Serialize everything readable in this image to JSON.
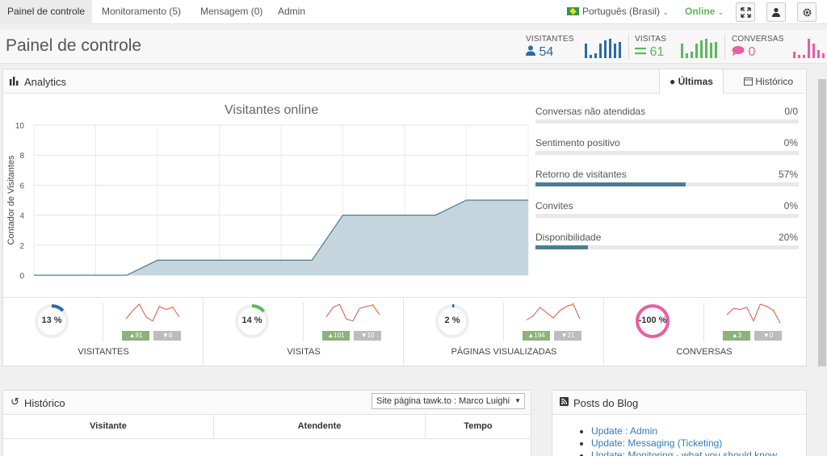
{
  "nav": {
    "items": [
      "Painel de controle",
      "Monitoramento (5)",
      "Mensagem (0)",
      "Admin"
    ],
    "language": "Português (Brasil)",
    "status": "Online"
  },
  "header": {
    "title": "Painel de controle",
    "stats": [
      {
        "label": "VISITANTES",
        "value": "54",
        "color": "#2a6ba0",
        "icon": "user-icon"
      },
      {
        "label": "VISITAS",
        "value": "61",
        "color": "#5cb85c",
        "icon": "bars-icon"
      },
      {
        "label": "CONVERSAS",
        "value": "0",
        "color": "#e85fa0",
        "icon": "chat-icon"
      }
    ]
  },
  "analytics": {
    "title": "Analytics",
    "tabs": [
      "Últimas",
      "Histórico"
    ],
    "metrics": [
      {
        "label": "Conversas não atendidas",
        "value": "0/0",
        "fill": 0
      },
      {
        "label": "Sentimento positivo",
        "value": "0%",
        "fill": 0
      },
      {
        "label": "Retorno de visitantes",
        "value": "57%",
        "fill": 0.57
      },
      {
        "label": "Convites",
        "value": "0%",
        "fill": 0
      },
      {
        "label": "Disponibilidade",
        "value": "20%",
        "fill": 0.2
      }
    ],
    "kpis": [
      {
        "caption": "VISITANTES",
        "percent": "13 %",
        "ratio": 0.13,
        "color": "#2a6ba0",
        "up": "91",
        "down": "8",
        "trend": [
          0.3,
          0.7,
          1.0,
          0.4,
          0.2,
          0.9,
          0.75,
          0.85,
          0.4
        ]
      },
      {
        "caption": "VISITAS",
        "percent": "14 %",
        "ratio": 0.14,
        "color": "#5cb85c",
        "up": "101",
        "down": "10",
        "trend": [
          0.4,
          0.85,
          1.0,
          0.3,
          0.2,
          0.8,
          0.9,
          0.95,
          0.5
        ]
      },
      {
        "caption": "PÁGINAS VISUALIZADAS",
        "percent": "2 %",
        "ratio": 0.02,
        "color": "#2a6ba0",
        "up": "194",
        "down": "21",
        "trend": [
          0.25,
          0.45,
          0.85,
          0.6,
          0.35,
          0.7,
          0.9,
          1.0,
          0.3
        ]
      },
      {
        "caption": "CONVERSAS",
        "percent": "-100 %",
        "ratio": 1,
        "color": "#e85fa0",
        "up": "3",
        "down": "0",
        "trend": [
          0.5,
          0.8,
          0.75,
          0.85,
          0.2,
          1.0,
          0.9,
          0.7,
          0.1
        ]
      }
    ]
  },
  "chart_data": {
    "type": "area",
    "title": "Visitantes online",
    "ylabel": "Contador de Visitantes",
    "xlabel": "",
    "ylim": [
      0,
      10
    ],
    "yticks": [
      0,
      2,
      4,
      6,
      8,
      10
    ],
    "x": [
      0,
      1,
      2,
      3,
      4,
      5,
      6,
      7,
      8,
      9,
      10,
      11,
      12,
      13,
      14,
      15,
      16
    ],
    "series": [
      {
        "values": [
          0,
          0,
          0,
          0,
          1,
          1,
          1,
          1,
          1,
          1,
          4,
          4,
          4,
          4,
          5,
          5,
          5
        ]
      }
    ],
    "grid": true
  },
  "history": {
    "title": "Histórico",
    "site_select": "Site página tawk.to : Marco Luighi",
    "columns": [
      "Visitante",
      "Atendente",
      "Tempo"
    ]
  },
  "blog": {
    "title": "Posts do Blog",
    "items": [
      "Update : Admin",
      "Update: Messaging (Ticketing)",
      "Update: Monitoring - what you should know"
    ]
  }
}
